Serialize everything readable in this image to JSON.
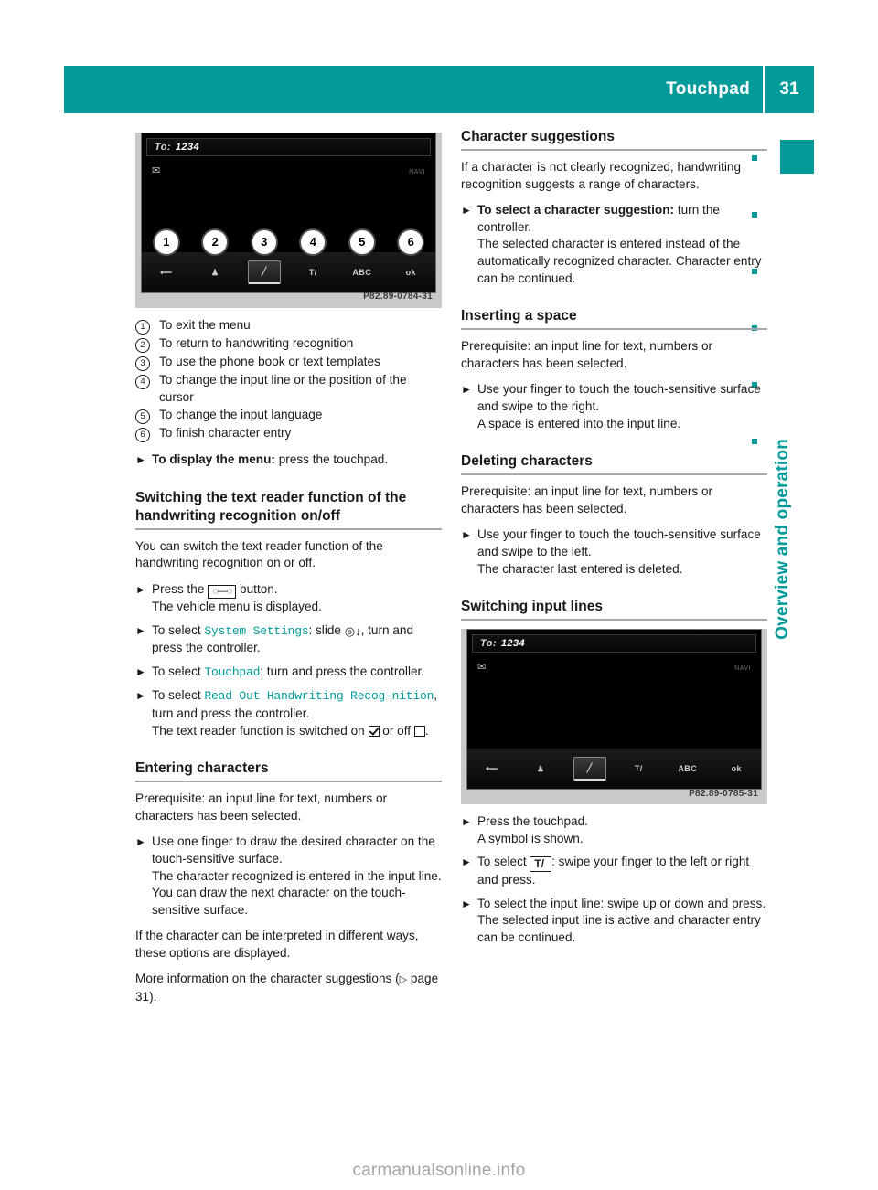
{
  "header": {
    "title": "Touchpad",
    "page_number": "31",
    "accent_color": "#009a9a"
  },
  "side_tab": {
    "label": "Overview and operation"
  },
  "figure_1": {
    "caption": "P82.89-0784-31",
    "to_label": "To:",
    "to_value": "1234",
    "nav_label": "NAVI",
    "envelope_icon": "envelope-icon",
    "toolbar": [
      {
        "icon": "back-arrow-icon",
        "glyph": "⟵"
      },
      {
        "icon": "phonebook-person-icon",
        "glyph": "♟"
      },
      {
        "icon": "pen-handwriting-icon",
        "glyph": "╱",
        "selected": true
      },
      {
        "icon": "t-slash-icon",
        "glyph": "T/"
      },
      {
        "icon": "abc-language-icon",
        "glyph": "ABC"
      },
      {
        "icon": "ok-icon",
        "glyph": "ok"
      }
    ],
    "callouts": [
      "1",
      "2",
      "3",
      "4",
      "5",
      "6"
    ]
  },
  "figure_2": {
    "caption": "P82.89-0785-31",
    "to_label": "To:",
    "to_value": "1234",
    "nav_label": "NAVI",
    "toolbar": [
      {
        "icon": "back-arrow-icon",
        "glyph": "⟵"
      },
      {
        "icon": "phonebook-person-icon",
        "glyph": "♟"
      },
      {
        "icon": "pen-handwriting-icon",
        "glyph": "╱",
        "selected": true
      },
      {
        "icon": "t-slash-icon",
        "glyph": "T/"
      },
      {
        "icon": "abc-language-icon",
        "glyph": "ABC"
      },
      {
        "icon": "ok-icon",
        "glyph": "ok"
      }
    ]
  },
  "legend": [
    {
      "num": "1",
      "text": "To exit the menu"
    },
    {
      "num": "2",
      "text": "To return to handwriting recognition"
    },
    {
      "num": "3",
      "text": "To use the phone book or text templates"
    },
    {
      "num": "4",
      "text": "To change the input line or the position of the cursor"
    },
    {
      "num": "5",
      "text": "To change the input language"
    },
    {
      "num": "6",
      "text": "To finish character entry"
    }
  ],
  "left": {
    "display_menu_step": {
      "bold": "To display the menu:",
      "rest": " press the touchpad."
    },
    "textreader": {
      "heading": "Switching the text reader function of the handwriting recognition on/off",
      "intro": "You can switch the text reader function of the handwriting recognition on or off.",
      "step_press_pre": "Press the ",
      "step_press_post": " button.",
      "step_press_sub": "The vehicle menu is displayed.",
      "step_sys_pre": "To select ",
      "step_sys_mono": "System Settings",
      "step_sys_mid": ": slide ",
      "step_sys_post": ", turn and press the controller.",
      "step_touch_pre": "To select ",
      "step_touch_mono": "Touchpad",
      "step_touch_post": ": turn and press the controller.",
      "step_read_pre": "To select ",
      "step_read_mono": "Read Out Handwriting Recog‑nition",
      "step_read_post": ", turn and press the controller.",
      "step_read_sub_pre": "The text reader function is switched on ",
      "step_read_sub_mid": " or off ",
      "step_read_sub_post": "."
    },
    "entering": {
      "heading": "Entering characters",
      "prereq": "Prerequisite: an input line for text, numbers or characters has been selected.",
      "step_draw": "Use one finger to draw the desired character on the touch-sensitive surface.",
      "step_draw_sub": "The character recognized is entered in the input line. You can draw the next character on the touch-sensitive surface.",
      "para_options": "If the character can be interpreted in different ways, these options are displayed.",
      "para_more_pre": "More information on the character suggestions (",
      "para_more_page": " page 31)."
    }
  },
  "right": {
    "suggestions": {
      "heading": "Character suggestions",
      "intro": "If a character is not clearly recognized, handwriting recognition suggests a range of characters.",
      "step_bold": "To select a character suggestion:",
      "step_rest": " turn the controller.",
      "step_sub": "The selected character is entered instead of the automatically recognized character. Character entry can be continued."
    },
    "space": {
      "heading": "Inserting a space",
      "prereq": "Prerequisite: an input line for text, numbers or characters has been selected.",
      "step": "Use your finger to touch the touch-sensitive surface and swipe to the right.",
      "step_sub": "A space is entered into the input line."
    },
    "delete": {
      "heading": "Deleting characters",
      "prereq": "Prerequisite: an input line for text, numbers or characters has been selected.",
      "step": "Use your finger to touch the touch-sensitive surface and swipe to the left.",
      "step_sub": "The character last entered is deleted."
    },
    "switching": {
      "heading": "Switching input lines",
      "step_press": "Press the touchpad.",
      "step_press_sub": "A symbol is shown.",
      "step_select_pre": "To select ",
      "step_select_post": ": swipe your finger to the left or right and press.",
      "step_line": "To select the input line: swipe up or down and press.",
      "step_line_sub": "The selected input line is active and character entry can be continued."
    }
  },
  "watermark": "carmanualsonline.info"
}
